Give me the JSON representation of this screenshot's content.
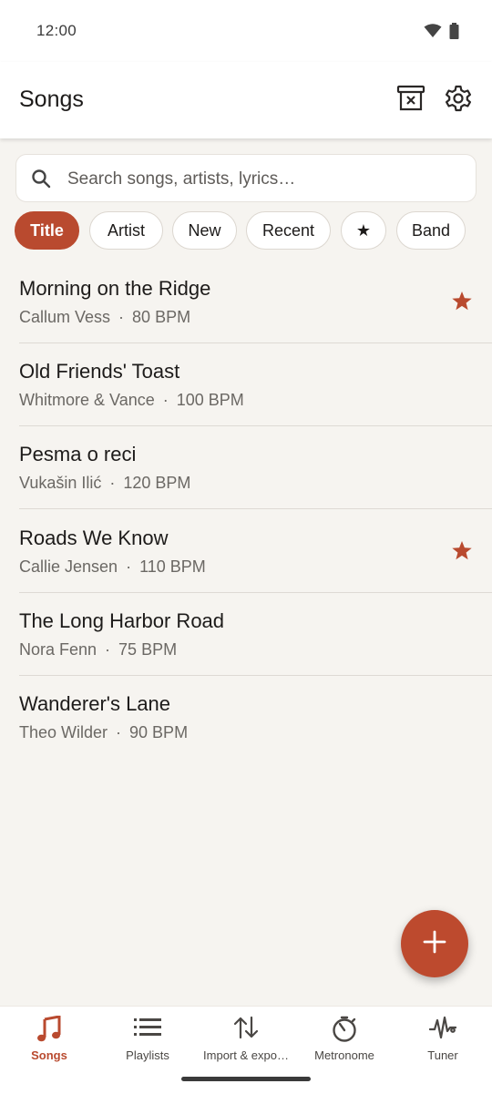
{
  "status_bar": {
    "time": "12:00",
    "icons": [
      "wifi-icon",
      "battery-icon"
    ]
  },
  "app_bar": {
    "title": "Songs",
    "actions": [
      "archive-x-icon",
      "settings-icon"
    ]
  },
  "search": {
    "placeholder": "Search songs, artists, lyrics…",
    "value": ""
  },
  "chips": [
    {
      "label": "Title",
      "active": true
    },
    {
      "label": "Artist",
      "active": false
    },
    {
      "label": "New",
      "active": false
    },
    {
      "label": "Recent",
      "active": false
    },
    {
      "label": "★",
      "active": false
    },
    {
      "label": "Band",
      "active": false
    }
  ],
  "songs": [
    {
      "title": "Morning on the Ridge",
      "artist": "Callum Vess",
      "bpm": "80 BPM",
      "starred": true
    },
    {
      "title": "Old Friends' Toast",
      "artist": "Whitmore & Vance",
      "bpm": "100 BPM",
      "starred": false
    },
    {
      "title": "Pesma o reci",
      "artist": "Vukašin Ilić",
      "bpm": "120 BPM",
      "starred": false
    },
    {
      "title": "Roads We Know",
      "artist": "Callie Jensen",
      "bpm": "110 BPM",
      "starred": true
    },
    {
      "title": "The Long Harbor Road",
      "artist": "Nora Fenn",
      "bpm": "75 BPM",
      "starred": false
    },
    {
      "title": "Wanderer's Lane",
      "artist": "Theo Wilder",
      "bpm": "90 BPM",
      "starred": false
    }
  ],
  "separator": "·",
  "fab": {
    "icon": "plus-icon"
  },
  "bottom_nav": [
    {
      "label": "Songs",
      "icon": "music-note-icon",
      "active": true
    },
    {
      "label": "Playlists",
      "icon": "list-icon",
      "active": false
    },
    {
      "label": "Import & expo…",
      "icon": "import-export-icon",
      "active": false
    },
    {
      "label": "Metronome",
      "icon": "metronome-icon",
      "active": false
    },
    {
      "label": "Tuner",
      "icon": "tuner-icon",
      "active": false
    }
  ],
  "colors": {
    "accent": "#b94a2f",
    "background": "#f6f4f0",
    "surface": "#ffffff"
  }
}
